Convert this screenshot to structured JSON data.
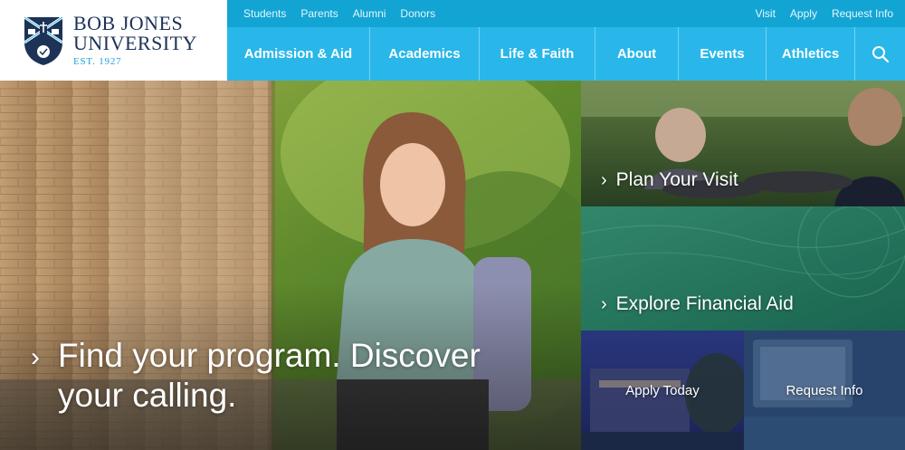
{
  "brand": {
    "name_line1": "BOB JONES",
    "name_line2": "UNIVERSITY",
    "established": "EST. 1927"
  },
  "utility_nav": {
    "left": [
      "Students",
      "Parents",
      "Alumni",
      "Donors"
    ],
    "right": [
      "Visit",
      "Apply",
      "Request Info"
    ]
  },
  "main_nav": [
    "Admission & Aid",
    "Academics",
    "Life & Faith",
    "About",
    "Events",
    "Athletics"
  ],
  "hero": {
    "caption": "Find your program. Discover your calling."
  },
  "tiles": {
    "visit": "Plan Your Visit",
    "aid": "Explore Financial Aid",
    "apply": "Apply Today",
    "request": "Request Info"
  },
  "colors": {
    "utility_bar": "#12a5d4",
    "main_nav": "#29b7ea",
    "brand_navy": "#1c3257"
  },
  "icons": {
    "search": "search-icon",
    "chevron": "chevron-right-icon",
    "crest": "university-crest-icon"
  }
}
